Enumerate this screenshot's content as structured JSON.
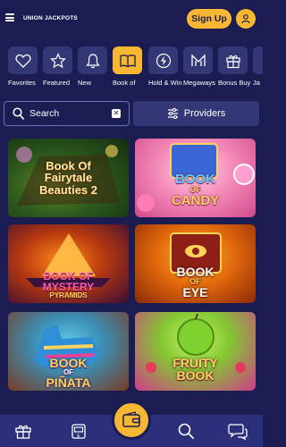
{
  "header": {
    "logo": "UNION JACKPOTS",
    "signup_label": "Sign Up"
  },
  "categories": [
    {
      "label": "Favorites",
      "icon": "heart-icon"
    },
    {
      "label": "Featured",
      "icon": "star-icon"
    },
    {
      "label": "New",
      "icon": "bell-icon"
    },
    {
      "label": "Book of",
      "icon": "book-icon",
      "active": true
    },
    {
      "label": "Hold & Win",
      "icon": "lightning-icon"
    },
    {
      "label": "Megaways",
      "icon": "megaways-icon"
    },
    {
      "label": "Bonus Buy",
      "icon": "gift-icon"
    },
    {
      "label": "Ja",
      "icon": "jackpot-icon"
    }
  ],
  "search": {
    "placeholder": "Search"
  },
  "providers": {
    "label": "Providers"
  },
  "games": [
    {
      "title_lines": [
        "Book Of",
        "Fairytale",
        "Beauties 2"
      ]
    },
    {
      "title_lines": [
        "BOOK",
        "OF",
        "CANDY"
      ]
    },
    {
      "title_lines": [
        "BOOK OF",
        "MYSTERY",
        "PYRAMIDS"
      ]
    },
    {
      "title_lines": [
        "BOOK",
        "OF",
        "EYE"
      ]
    },
    {
      "title_lines": [
        "BOOK",
        "OF",
        "PIÑATA"
      ]
    },
    {
      "title_lines": [
        "FRUITY",
        "BOOK"
      ]
    }
  ],
  "colors": {
    "background": "#1b1d52",
    "accent": "#f7b733",
    "tile": "#343775",
    "nav": "#2c2f7a"
  }
}
